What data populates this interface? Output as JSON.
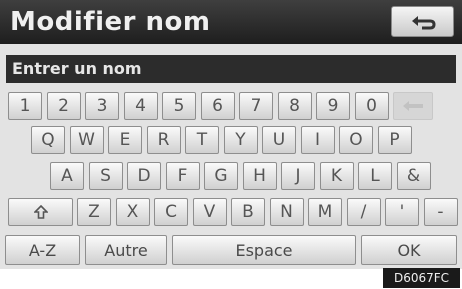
{
  "header": {
    "title": "Modifier nom",
    "back_icon": "return-arrow-icon"
  },
  "input": {
    "placeholder": "Entrer un nom"
  },
  "keyboard": {
    "digits": [
      "1",
      "2",
      "3",
      "4",
      "5",
      "6",
      "7",
      "8",
      "9",
      "0"
    ],
    "delete_icon": "backspace-arrow-icon",
    "row_qwerty": [
      "Q",
      "W",
      "E",
      "R",
      "T",
      "Y",
      "U",
      "I",
      "O",
      "P"
    ],
    "row_asdf": [
      "A",
      "S",
      "D",
      "F",
      "G",
      "H",
      "J",
      "K",
      "L",
      "&"
    ],
    "shift_icon": "shift-arrow-icon",
    "row_zxcv": [
      "Z",
      "X",
      "C",
      "V",
      "B",
      "N",
      "M",
      "/",
      "'",
      "-"
    ]
  },
  "bottom": {
    "az": "A-Z",
    "other": "Autre",
    "space": "Espace",
    "ok": "OK"
  },
  "figure_code": "D6067FC"
}
